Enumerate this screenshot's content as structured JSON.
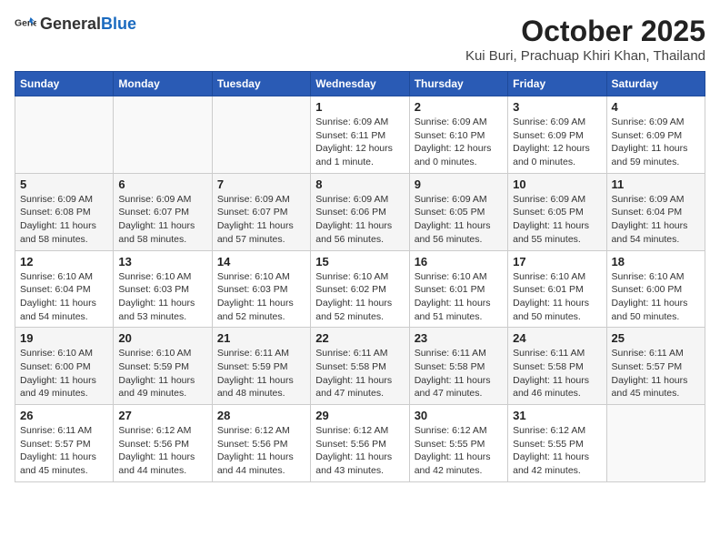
{
  "logo": {
    "general": "General",
    "blue": "Blue"
  },
  "title": "October 2025",
  "subtitle": "Kui Buri, Prachuap Khiri Khan, Thailand",
  "headers": [
    "Sunday",
    "Monday",
    "Tuesday",
    "Wednesday",
    "Thursday",
    "Friday",
    "Saturday"
  ],
  "weeks": [
    [
      {
        "date": "",
        "sunrise": "",
        "sunset": "",
        "daylight": ""
      },
      {
        "date": "",
        "sunrise": "",
        "sunset": "",
        "daylight": ""
      },
      {
        "date": "",
        "sunrise": "",
        "sunset": "",
        "daylight": ""
      },
      {
        "date": "1",
        "sunrise": "Sunrise: 6:09 AM",
        "sunset": "Sunset: 6:11 PM",
        "daylight": "Daylight: 12 hours and 1 minute."
      },
      {
        "date": "2",
        "sunrise": "Sunrise: 6:09 AM",
        "sunset": "Sunset: 6:10 PM",
        "daylight": "Daylight: 12 hours and 0 minutes."
      },
      {
        "date": "3",
        "sunrise": "Sunrise: 6:09 AM",
        "sunset": "Sunset: 6:09 PM",
        "daylight": "Daylight: 12 hours and 0 minutes."
      },
      {
        "date": "4",
        "sunrise": "Sunrise: 6:09 AM",
        "sunset": "Sunset: 6:09 PM",
        "daylight": "Daylight: 11 hours and 59 minutes."
      }
    ],
    [
      {
        "date": "5",
        "sunrise": "Sunrise: 6:09 AM",
        "sunset": "Sunset: 6:08 PM",
        "daylight": "Daylight: 11 hours and 58 minutes."
      },
      {
        "date": "6",
        "sunrise": "Sunrise: 6:09 AM",
        "sunset": "Sunset: 6:07 PM",
        "daylight": "Daylight: 11 hours and 58 minutes."
      },
      {
        "date": "7",
        "sunrise": "Sunrise: 6:09 AM",
        "sunset": "Sunset: 6:07 PM",
        "daylight": "Daylight: 11 hours and 57 minutes."
      },
      {
        "date": "8",
        "sunrise": "Sunrise: 6:09 AM",
        "sunset": "Sunset: 6:06 PM",
        "daylight": "Daylight: 11 hours and 56 minutes."
      },
      {
        "date": "9",
        "sunrise": "Sunrise: 6:09 AM",
        "sunset": "Sunset: 6:05 PM",
        "daylight": "Daylight: 11 hours and 56 minutes."
      },
      {
        "date": "10",
        "sunrise": "Sunrise: 6:09 AM",
        "sunset": "Sunset: 6:05 PM",
        "daylight": "Daylight: 11 hours and 55 minutes."
      },
      {
        "date": "11",
        "sunrise": "Sunrise: 6:09 AM",
        "sunset": "Sunset: 6:04 PM",
        "daylight": "Daylight: 11 hours and 54 minutes."
      }
    ],
    [
      {
        "date": "12",
        "sunrise": "Sunrise: 6:10 AM",
        "sunset": "Sunset: 6:04 PM",
        "daylight": "Daylight: 11 hours and 54 minutes."
      },
      {
        "date": "13",
        "sunrise": "Sunrise: 6:10 AM",
        "sunset": "Sunset: 6:03 PM",
        "daylight": "Daylight: 11 hours and 53 minutes."
      },
      {
        "date": "14",
        "sunrise": "Sunrise: 6:10 AM",
        "sunset": "Sunset: 6:03 PM",
        "daylight": "Daylight: 11 hours and 52 minutes."
      },
      {
        "date": "15",
        "sunrise": "Sunrise: 6:10 AM",
        "sunset": "Sunset: 6:02 PM",
        "daylight": "Daylight: 11 hours and 52 minutes."
      },
      {
        "date": "16",
        "sunrise": "Sunrise: 6:10 AM",
        "sunset": "Sunset: 6:01 PM",
        "daylight": "Daylight: 11 hours and 51 minutes."
      },
      {
        "date": "17",
        "sunrise": "Sunrise: 6:10 AM",
        "sunset": "Sunset: 6:01 PM",
        "daylight": "Daylight: 11 hours and 50 minutes."
      },
      {
        "date": "18",
        "sunrise": "Sunrise: 6:10 AM",
        "sunset": "Sunset: 6:00 PM",
        "daylight": "Daylight: 11 hours and 50 minutes."
      }
    ],
    [
      {
        "date": "19",
        "sunrise": "Sunrise: 6:10 AM",
        "sunset": "Sunset: 6:00 PM",
        "daylight": "Daylight: 11 hours and 49 minutes."
      },
      {
        "date": "20",
        "sunrise": "Sunrise: 6:10 AM",
        "sunset": "Sunset: 5:59 PM",
        "daylight": "Daylight: 11 hours and 49 minutes."
      },
      {
        "date": "21",
        "sunrise": "Sunrise: 6:11 AM",
        "sunset": "Sunset: 5:59 PM",
        "daylight": "Daylight: 11 hours and 48 minutes."
      },
      {
        "date": "22",
        "sunrise": "Sunrise: 6:11 AM",
        "sunset": "Sunset: 5:58 PM",
        "daylight": "Daylight: 11 hours and 47 minutes."
      },
      {
        "date": "23",
        "sunrise": "Sunrise: 6:11 AM",
        "sunset": "Sunset: 5:58 PM",
        "daylight": "Daylight: 11 hours and 47 minutes."
      },
      {
        "date": "24",
        "sunrise": "Sunrise: 6:11 AM",
        "sunset": "Sunset: 5:58 PM",
        "daylight": "Daylight: 11 hours and 46 minutes."
      },
      {
        "date": "25",
        "sunrise": "Sunrise: 6:11 AM",
        "sunset": "Sunset: 5:57 PM",
        "daylight": "Daylight: 11 hours and 45 minutes."
      }
    ],
    [
      {
        "date": "26",
        "sunrise": "Sunrise: 6:11 AM",
        "sunset": "Sunset: 5:57 PM",
        "daylight": "Daylight: 11 hours and 45 minutes."
      },
      {
        "date": "27",
        "sunrise": "Sunrise: 6:12 AM",
        "sunset": "Sunset: 5:56 PM",
        "daylight": "Daylight: 11 hours and 44 minutes."
      },
      {
        "date": "28",
        "sunrise": "Sunrise: 6:12 AM",
        "sunset": "Sunset: 5:56 PM",
        "daylight": "Daylight: 11 hours and 44 minutes."
      },
      {
        "date": "29",
        "sunrise": "Sunrise: 6:12 AM",
        "sunset": "Sunset: 5:56 PM",
        "daylight": "Daylight: 11 hours and 43 minutes."
      },
      {
        "date": "30",
        "sunrise": "Sunrise: 6:12 AM",
        "sunset": "Sunset: 5:55 PM",
        "daylight": "Daylight: 11 hours and 42 minutes."
      },
      {
        "date": "31",
        "sunrise": "Sunrise: 6:12 AM",
        "sunset": "Sunset: 5:55 PM",
        "daylight": "Daylight: 11 hours and 42 minutes."
      },
      {
        "date": "",
        "sunrise": "",
        "sunset": "",
        "daylight": ""
      }
    ]
  ]
}
